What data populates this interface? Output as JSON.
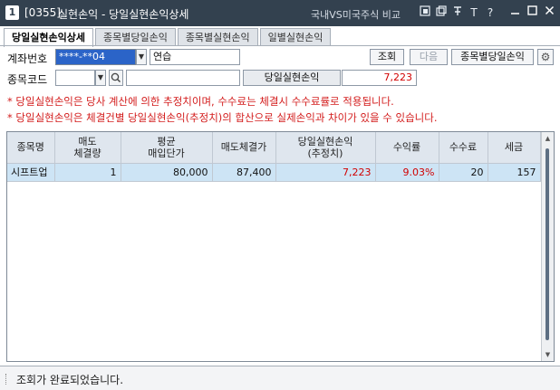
{
  "window": {
    "number": "1",
    "code": "[0355]",
    "title": "실현손익 - 당일실현손익상세",
    "compare_link": "국내VS미국주식 비교",
    "toolbar_icons": [
      "link-icon",
      "copy-window-icon",
      "pin-icon",
      "font-size-icon",
      "help-icon"
    ],
    "controls": [
      "minimize",
      "maximize",
      "close"
    ]
  },
  "tabs": [
    {
      "label": "당일실현손익상세",
      "active": true
    },
    {
      "label": "종목별당일손익",
      "active": false
    },
    {
      "label": "종목별실현손익",
      "active": false
    },
    {
      "label": "일별실현손익",
      "active": false
    }
  ],
  "form": {
    "account_label": "계좌번호",
    "account_value": "****-**04",
    "account_name": "연습",
    "query_btn": "조회",
    "next_btn": "다음",
    "by_stock_btn": "종목별당일손익",
    "code_label": "종목코드",
    "code_value": "",
    "name_value": "",
    "pl_label": "당일실현손익",
    "pl_value": "7,223"
  },
  "notes": [
    "* 당일실현손익은 당사 계산에 의한 추정치이며, 수수료는 체결시 수수료률로 적용됩니다.",
    "* 당일실현손익은 체결건별 당일실현손익(추정치)의 합산으로 실제손익과 차이가 있을 수 있습니다."
  ],
  "table": {
    "headers": [
      {
        "l1": "종목명",
        "l2": ""
      },
      {
        "l1": "매도",
        "l2": "체결량"
      },
      {
        "l1": "평균",
        "l2": "매입단가"
      },
      {
        "l1": "매도체결가",
        "l2": ""
      },
      {
        "l1": "당일실현손익",
        "l2": "(추정치)"
      },
      {
        "l1": "수익률",
        "l2": ""
      },
      {
        "l1": "수수료",
        "l2": ""
      },
      {
        "l1": "세금",
        "l2": ""
      }
    ],
    "rows": [
      {
        "name": "시프트업",
        "sell_qty": "1",
        "avg_buy_price": "80,000",
        "sell_price": "87,400",
        "realized_pl": "7,223",
        "return_rate": "9.03%",
        "fee": "20",
        "tax": "157"
      }
    ]
  },
  "status": {
    "message": "조회가 완료되었습니다."
  },
  "colors": {
    "titlebar": "#33414f",
    "accent_blue": "#2b64c8",
    "profit_red": "#d10000",
    "note_red": "#d31c1c",
    "row_selected": "#cde4f5"
  }
}
